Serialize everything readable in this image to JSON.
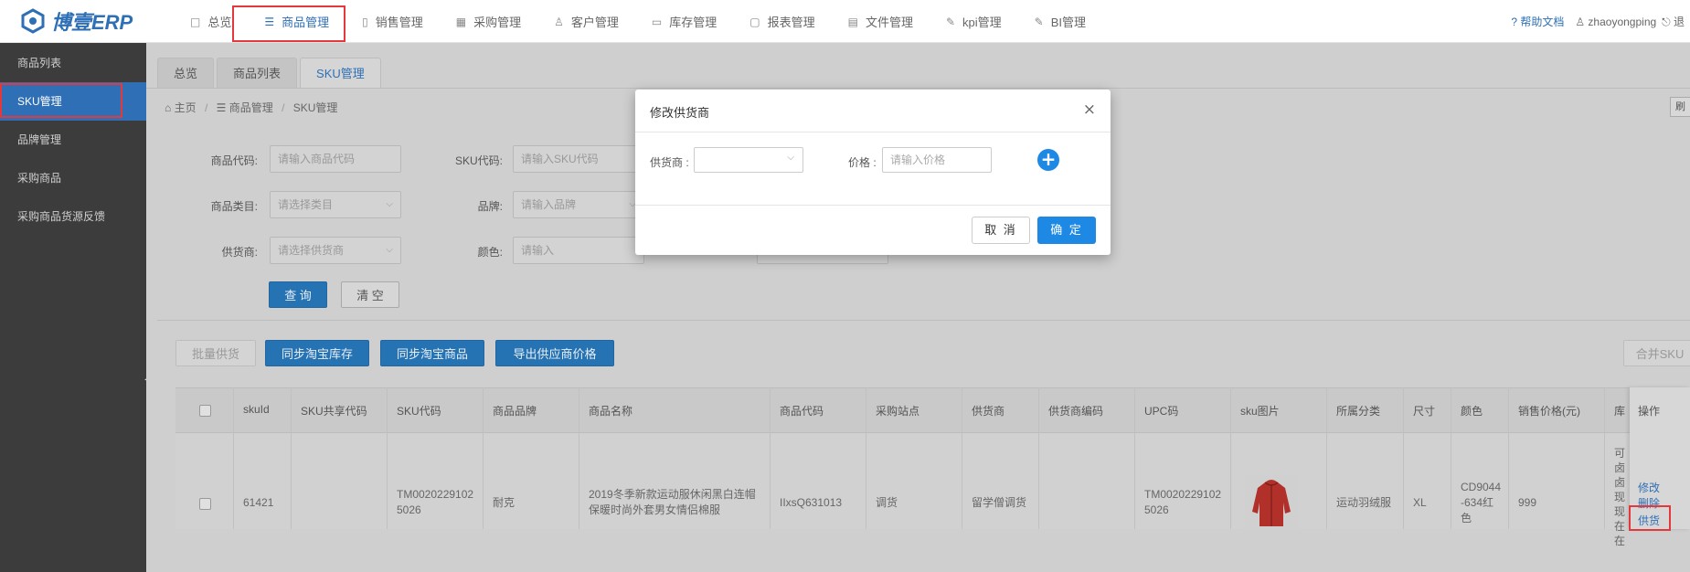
{
  "app": {
    "logo_text": "博壹ERP"
  },
  "nav": {
    "items": [
      {
        "icon": "□",
        "label": "总览"
      },
      {
        "icon": "☰",
        "label": "商品管理"
      },
      {
        "icon": "▯",
        "label": "销售管理"
      },
      {
        "icon": "▦",
        "label": "采购管理"
      },
      {
        "icon": "♙",
        "label": "客户管理"
      },
      {
        "icon": "▭",
        "label": "库存管理"
      },
      {
        "icon": "▢",
        "label": "报表管理"
      },
      {
        "icon": "▤",
        "label": "文件管理"
      },
      {
        "icon": "✎",
        "label": "kpi管理"
      },
      {
        "icon": "✎",
        "label": "BI管理"
      }
    ],
    "help": "? 帮助文档",
    "user": "♙ zhaoyongping",
    "logout": "⎋ 退"
  },
  "sidebar": {
    "items": [
      {
        "label": "商品列表"
      },
      {
        "label": "SKU管理"
      },
      {
        "label": "品牌管理"
      },
      {
        "label": "采购商品"
      },
      {
        "label": "采购商品货源反馈"
      }
    ]
  },
  "tabs": [
    {
      "label": "总览"
    },
    {
      "label": "商品列表"
    },
    {
      "label": "SKU管理"
    }
  ],
  "breadcrumb": {
    "home": "⌂ 主页",
    "sep": "/",
    "section": "☰ 商品管理",
    "current": "SKU管理",
    "right_btn": "刷"
  },
  "filters": {
    "product_code": {
      "label": "商品代码:",
      "placeholder": "请输入商品代码"
    },
    "sku_code": {
      "label": "SKU代码:",
      "placeholder": "请输入SKU代码"
    },
    "category": {
      "label": "商品类目:",
      "placeholder": "请选择类目"
    },
    "brand": {
      "label": "品牌:",
      "placeholder": "请输入品牌"
    },
    "supplier": {
      "label": "供货商:",
      "placeholder": "请选择供货商"
    },
    "color": {
      "label": "颜色:",
      "placeholder": "请输入"
    },
    "query_btn": "查 询",
    "clear_btn": "清 空"
  },
  "actions": {
    "batch_supply": "批量供货",
    "sync_taobao_stock": "同步淘宝库存",
    "sync_taobao_goods": "同步淘宝商品",
    "export_prices": "导出供应商价格",
    "merge_sku": "合并SKU"
  },
  "table": {
    "headers": [
      "skuId",
      "SKU共享代码",
      "SKU代码",
      "商品品牌",
      "商品名称",
      "商品代码",
      "采购站点",
      "供货商",
      "供货商编码",
      "UPC码",
      "sku图片",
      "所属分类",
      "尺寸",
      "颜色",
      "销售价格(元)",
      "库",
      "操作"
    ],
    "row": {
      "skuId": "61421",
      "shared_code": "",
      "sku_code_1": "TM0020229102",
      "sku_code_2": "5026",
      "brand": "耐克",
      "name_1": "2019冬季新款运动服休闲黑白连帽",
      "name_2": "保暖时尚外套男女情侣棉服",
      "product_code": "IIxsQ631013",
      "site": "调货",
      "supplier": "留学僧调货",
      "supplier_code": "",
      "upc_1": "TM0020229102",
      "upc_2": "5026",
      "category": "运动羽绒服",
      "size": "XL",
      "color_1": "CD9044",
      "color_2": "-634红",
      "color_3": "色",
      "price": "999",
      "stock_lines": [
        "可",
        "卤",
        "卤",
        "现",
        "现",
        "在",
        "在"
      ],
      "op_edit": "修改",
      "op_delete": "删除",
      "op_supply": "供货"
    }
  },
  "modal": {
    "title": "修改供货商",
    "close": "×",
    "supplier_label": "供货商 :",
    "price_label": "价格 :",
    "price_placeholder": "请输入价格",
    "add": "+",
    "cancel": "取 消",
    "ok": "确 定"
  },
  "colors": {
    "primary": "#2f6fb5",
    "modal_primary": "#1e88e5",
    "highlight": "#e4393c",
    "sidebar_bg": "#3c3c3c"
  }
}
